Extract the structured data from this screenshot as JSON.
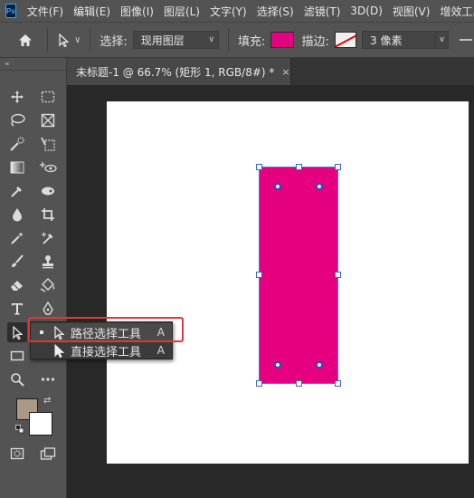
{
  "app": {
    "logo": "Ps"
  },
  "menu": [
    "文件(F)",
    "编辑(E)",
    "图像(I)",
    "图层(L)",
    "文字(Y)",
    "选择(S)",
    "滤镜(T)",
    "3D(D)",
    "视图(V)",
    "增效工具"
  ],
  "options": {
    "select_label": "选择:",
    "select_value": "现用图层",
    "fill_label": "填充:",
    "fill_color": "#e4007f",
    "stroke_label": "描边:",
    "stroke_width": "3 像素"
  },
  "document_tab": {
    "title": "未标题-1 @ 66.7% (矩形 1, RGB/8#) *",
    "close": "×"
  },
  "toolbar": {
    "collapse": "«"
  },
  "flyout": {
    "items": [
      {
        "label": "路径选择工具",
        "shortcut": "A",
        "selected": true
      },
      {
        "label": "直接选择工具",
        "shortcut": "A",
        "selected": false
      }
    ]
  },
  "colors": {
    "foreground": "#a89a86",
    "background": "#ffffff",
    "canvas": "#ffffff",
    "shape": "#e4007f",
    "highlight": "#e3353f"
  },
  "icons": [
    "home-icon",
    "path-selection-icon",
    "move-icon",
    "marquee-icon",
    "lasso-icon",
    "frame-icon",
    "quick-select-icon",
    "slice-icon",
    "gradient-icon",
    "3d-icon",
    "eyedropper-icon",
    "eraser-icon",
    "blur-icon",
    "crop-icon",
    "magic-wand-icon",
    "color-sampler-icon",
    "brush-icon",
    "stamp-icon",
    "eraser-icon",
    "paint-bucket-icon",
    "type-icon",
    "pen-icon",
    "rectangle-icon",
    "zoom-icon",
    "more-icon",
    "quick-mask-icon",
    "screen-mode-icon"
  ]
}
